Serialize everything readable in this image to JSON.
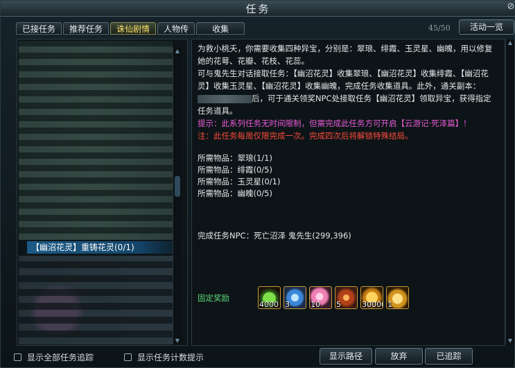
{
  "window": {
    "title": "任务"
  },
  "tabs": [
    {
      "label": "已接任务",
      "active": false
    },
    {
      "label": "推荐任务",
      "active": false
    },
    {
      "label": "诛仙剧情",
      "active": true
    },
    {
      "label": "人物传",
      "active": false
    },
    {
      "label": "收集",
      "active": false
    }
  ],
  "header": {
    "counter": "45/50",
    "activity_button": "活动一览"
  },
  "quest_list": {
    "selected_item": "【幽沼花灵】重铸花灵(0/1)"
  },
  "detail": {
    "desc_line1": "为救小桃夭，你需要收集四种异宝，分别是：翠琅、绯霞、玉灵星、幽魄，用以修复她的花萼、花瓣、花枝、花蕊。",
    "desc_line2a": "可与鬼先生对话接取任务：【幽沼花灵】收集翠琅、【幽沼花灵】收集绯霞、【幽沼花灵】收集玉灵星、【幽沼花灵】收集幽魄，完成任务收集道具。此外，通关副本：",
    "desc_line2b": "后，可于通关领奖NPC处接取任务【幽沼花灵】领取异宝，获得指定任务道具。",
    "tip_purple": "提示：此系列任务无时间限制，但需完成此任务方可开启【云游记·死泽篇】！",
    "tip_red": "注：此任务每周仅限完成一次。完成四次后将解锁特殊结局。",
    "requirements": [
      "所需物品：翠琅(1/1)",
      "所需物品：绯霞(0/5)",
      "所需物品：玉灵星(0/1)",
      "所需物品：幽魄(0/5)"
    ],
    "npc": "完成任务NPC：死亡沼泽 鬼先生(299,396)",
    "reward_label": "固定奖励",
    "rewards": [
      {
        "icon": "green-gourd-icon",
        "qty": "4000"
      },
      {
        "icon": "blue-orb-icon",
        "qty": "3"
      },
      {
        "icon": "pink-petal-icon",
        "qty": "10"
      },
      {
        "icon": "fire-emblem-icon",
        "qty": "5"
      },
      {
        "icon": "gold-ingot-icon",
        "qty": "30000"
      },
      {
        "icon": "gold-fan-icon",
        "qty": "1"
      }
    ]
  },
  "footer": {
    "chk_all": "显示全部任务追踪",
    "chk_count": "显示任务计数提示",
    "btn_path": "显示路径",
    "btn_abandon": "放弃",
    "btn_tracked": "已追踪"
  }
}
